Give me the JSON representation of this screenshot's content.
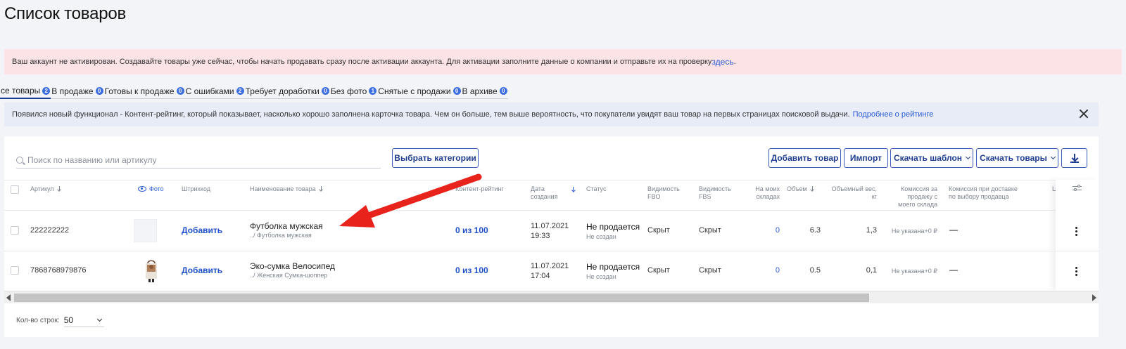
{
  "page": {
    "title": "Список товаров"
  },
  "alert_account": {
    "text": "Ваш аккаунт не активирован. Создавайте товары уже сейчас, чтобы начать продавать сразу после активации аккаунта. Для активации заполните данные о компании и отправьте их на проверку",
    "link": "здесь",
    "suffix": "."
  },
  "tabs": [
    {
      "label": "се товары",
      "count": "2"
    },
    {
      "label": "В продаже",
      "count": "0"
    },
    {
      "label": "Готовы к продаже",
      "count": "0"
    },
    {
      "label": "С ошибками",
      "count": "2"
    },
    {
      "label": "Требует доработки",
      "count": "0"
    },
    {
      "label": "Без фото",
      "count": "1"
    },
    {
      "label": "Снятые с продажи",
      "count": "0"
    },
    {
      "label": "В архиве",
      "count": "0"
    }
  ],
  "alert_info": {
    "text": "Появился новый функционал - Контент-рейтинг, который показывает, насколько хорошо заполнена карточка товара. Чем он больше, тем выше вероятность, что покупатели увидят ваш товар на первых страницах поисковой выдачи.",
    "link": "Подробнее о рейтинге"
  },
  "toolbar": {
    "search_placeholder": "Поиск по названию или артикулу",
    "categories_label": "Выбрать категории",
    "add_product_label": "Добавить товар",
    "import_label": "Импорт",
    "download_template_label": "Скачать шаблон",
    "download_products_label": "Скачать товары"
  },
  "columns": {
    "article": "Артикул",
    "photo": "Фото",
    "barcode": "Штрихкод",
    "name": "Наименование товара",
    "content_rating": "Контент-рейтинг",
    "created_1": "Дата",
    "created_2": "создания",
    "status": "Статус",
    "fbo_1": "Видимость",
    "fbo_2": "FBO",
    "fbs_1": "Видимость",
    "fbs_2": "FBS",
    "stock_1": "На моих",
    "stock_2": "складах",
    "volume": "Объем",
    "vol_weight_1": "Объемный вес,",
    "vol_weight_2": "кг",
    "commission_1": "Комиссия за",
    "commission_2": "продажу с",
    "commission_3": "моего склада",
    "delivery_1": "Комиссия при доставке",
    "delivery_2": "по выбору продавца",
    "cut": "Ц"
  },
  "rows": [
    {
      "article": "222222222",
      "barcode_action": "Добавить",
      "name": "Футболка мужская",
      "path": "../ Футболка мужская",
      "rating": "0 из 100",
      "date": "11.07.2021",
      "time": "19:33",
      "status": "Не продается",
      "status_sub": "Не создан",
      "fbo": "Скрыт",
      "fbs": "Скрыт",
      "stock": "0",
      "volume": "6.3",
      "vol_weight": "1,3",
      "commission": "Не указана+0 ₽",
      "delivery": "—"
    },
    {
      "article": "7868768979876",
      "barcode_action": "Добавить",
      "name": "Эко-сумка Велосипед",
      "path": "../ Женская Сумка-шоппер",
      "rating": "0 из 100",
      "date": "11.07.2021",
      "time": "17:04",
      "status": "Не продается",
      "status_sub": "Не создан",
      "fbo": "Скрыт",
      "fbs": "Скрыт",
      "stock": "0",
      "volume": "0.5",
      "vol_weight": "0,1",
      "commission": "Не указана+0 ₽",
      "delivery": "—"
    }
  ],
  "footer": {
    "rows_label": "Кол-во строк:",
    "rows_value": "50"
  },
  "colors": {
    "accent": "#1f3d8f",
    "link": "#2c5ad8",
    "alert_pink": "#fbe3e6",
    "alert_blue": "#e7ecf7",
    "annotation_arrow": "#e8231b"
  }
}
